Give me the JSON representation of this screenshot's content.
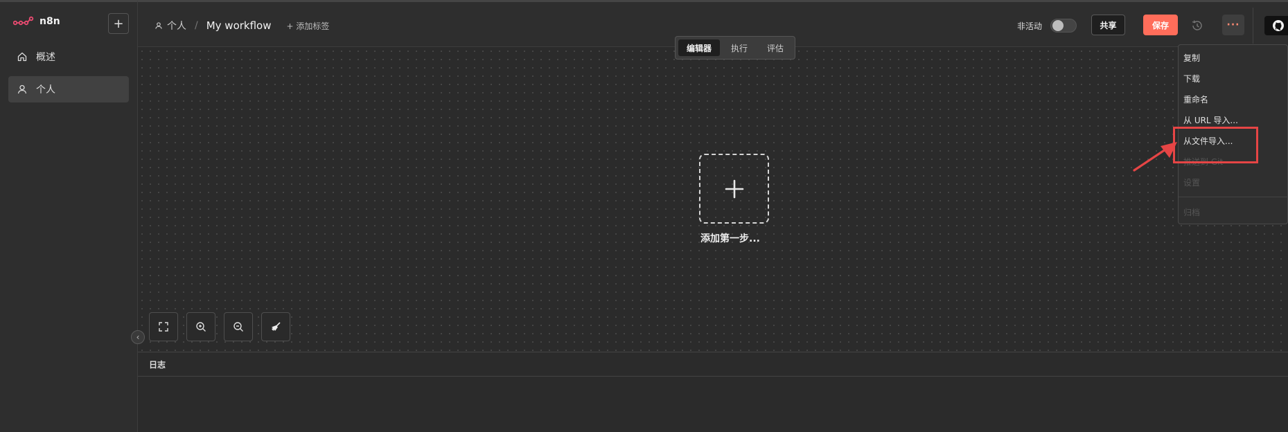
{
  "sidebar": {
    "logo_text": "n8n",
    "add_label": "+",
    "items": [
      {
        "label": "概述",
        "icon": "home-icon"
      },
      {
        "label": "个人",
        "icon": "user-icon"
      }
    ],
    "collapse_glyph": "‹"
  },
  "header": {
    "breadcrumb_project": "个人",
    "breadcrumb_sep": "/",
    "workflow_name": "My workflow",
    "add_tag": "+ 添加标签",
    "status_label": "非活动",
    "share_label": "共享",
    "save_label": "保存",
    "more_label": "···"
  },
  "tabs": [
    {
      "label": "编辑器",
      "active": true
    },
    {
      "label": "执行",
      "active": false
    },
    {
      "label": "评估",
      "active": false
    }
  ],
  "canvas": {
    "add_first_step": "添加第一步..."
  },
  "log": {
    "title": "日志"
  },
  "menu": {
    "items": [
      {
        "label": "复制",
        "disabled": false
      },
      {
        "label": "下载",
        "disabled": false
      },
      {
        "label": "重命名",
        "disabled": false
      },
      {
        "label": "从 URL 导入...",
        "disabled": false
      },
      {
        "label": "从文件导入...",
        "disabled": false
      },
      {
        "label": "推送到 Git",
        "disabled": true
      },
      {
        "label": "设置",
        "disabled": true
      },
      {
        "label": "归档",
        "disabled": true
      }
    ]
  },
  "colors": {
    "accent": "#ff6d5a",
    "highlight": "#e64545"
  }
}
